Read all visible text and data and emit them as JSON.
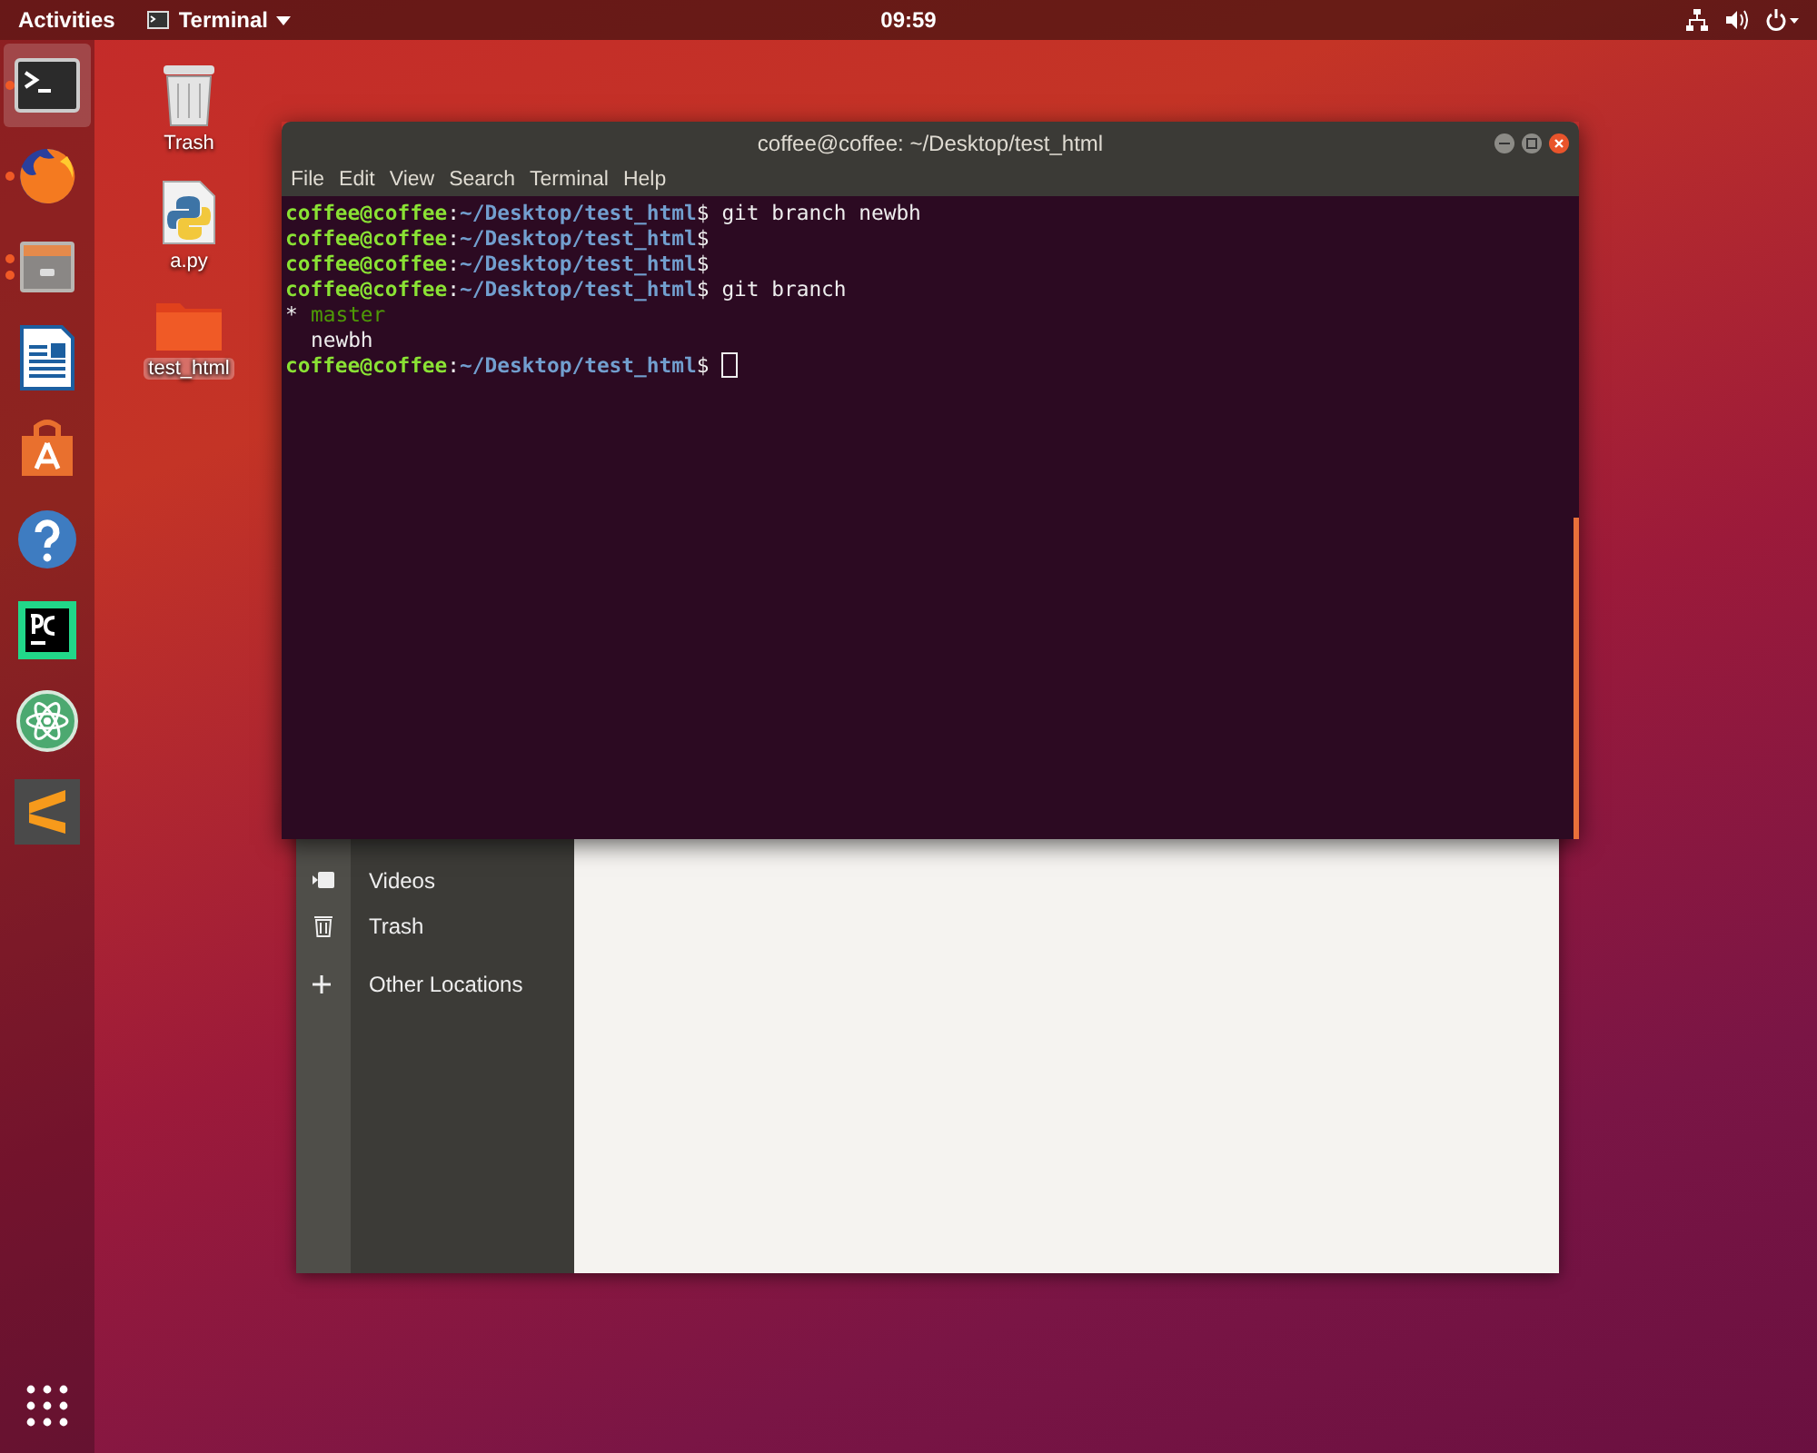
{
  "top_bar": {
    "activities": "Activities",
    "app_menu": "Terminal",
    "clock": "09:59"
  },
  "dock": {
    "items": [
      {
        "kind": "terminal",
        "selected": true,
        "running": true,
        "multiple_windows": false
      },
      {
        "kind": "browser",
        "selected": false,
        "running": true,
        "multiple_windows": false
      },
      {
        "kind": "files",
        "selected": false,
        "running": true,
        "multiple_windows": true
      },
      {
        "kind": "writer",
        "selected": false,
        "running": false,
        "multiple_windows": false
      },
      {
        "kind": "software",
        "selected": false,
        "running": false,
        "multiple_windows": false
      },
      {
        "kind": "help",
        "selected": false,
        "running": false,
        "multiple_windows": false
      },
      {
        "kind": "ide",
        "selected": false,
        "running": false,
        "multiple_windows": false
      },
      {
        "kind": "atom",
        "selected": false,
        "running": false,
        "multiple_windows": false
      },
      {
        "kind": "editor",
        "selected": false,
        "running": false,
        "multiple_windows": false
      }
    ]
  },
  "desktop_icons": [
    {
      "kind": "trash",
      "label": "Trash",
      "selected": false
    },
    {
      "kind": "python",
      "label": "a.py",
      "selected": false
    },
    {
      "kind": "folder",
      "label": "test_html",
      "selected": true
    }
  ],
  "files_window": {
    "sidebar": [
      {
        "kind": "video",
        "label": "Videos"
      },
      {
        "kind": "trash",
        "label": "Trash"
      },
      {
        "kind": "plus",
        "label": "Other Locations"
      }
    ]
  },
  "terminal": {
    "title": "coffee@coffee: ~/Desktop/test_html",
    "menu": [
      "File",
      "Edit",
      "View",
      "Search",
      "Terminal",
      "Help"
    ],
    "lines": [
      {
        "kind": "prompt",
        "user": "coffee@coffee",
        "separator": ":",
        "path": "~/Desktop/test_html",
        "sign": "$",
        "command": "git branch newbh",
        "cursor": false
      },
      {
        "kind": "prompt",
        "user": "coffee@coffee",
        "separator": ":",
        "path": "~/Desktop/test_html",
        "sign": "$",
        "cursor": false
      },
      {
        "kind": "prompt",
        "user": "coffee@coffee",
        "separator": ":",
        "path": "~/Desktop/test_html",
        "sign": "$",
        "cursor": false
      },
      {
        "kind": "prompt",
        "user": "coffee@coffee",
        "separator": ":",
        "path": "~/Desktop/test_html",
        "sign": "$",
        "command": "git branch",
        "cursor": false
      },
      {
        "kind": "branch",
        "marker": "*",
        "name": "master",
        "current": true
      },
      {
        "kind": "branch",
        "name": "newbh",
        "current": false
      },
      {
        "kind": "prompt",
        "user": "coffee@coffee",
        "separator": ":",
        "path": "~/Desktop/test_html",
        "sign": "$",
        "cursor": true
      }
    ]
  }
}
